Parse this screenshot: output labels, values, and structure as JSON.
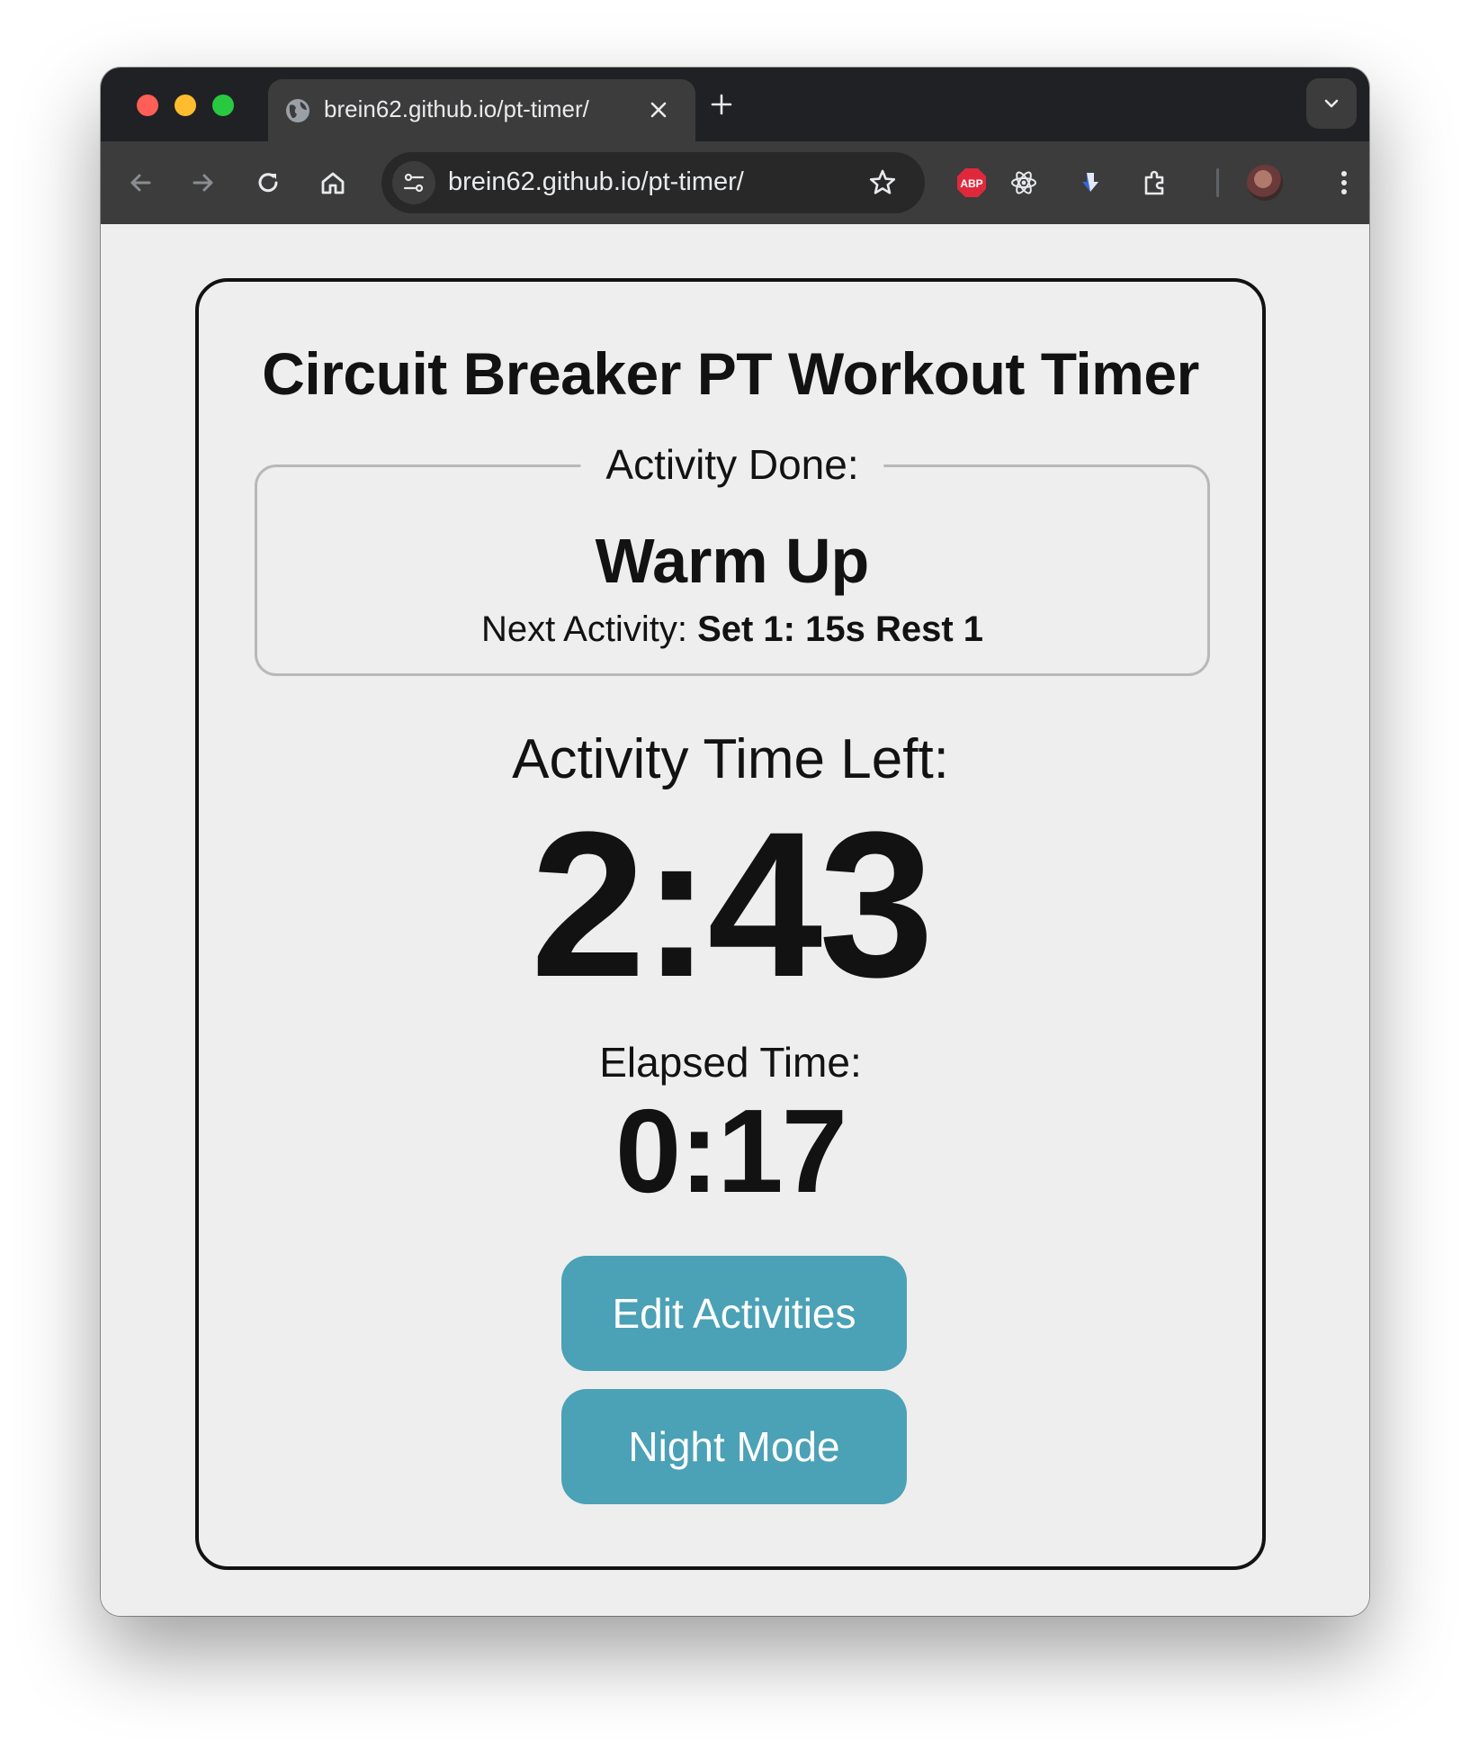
{
  "browser": {
    "tab_title": "brein62.github.io/pt-timer/",
    "url": "brein62.github.io/pt-timer/",
    "extension_abp_label": "ABP",
    "icons": {
      "back": "arrow-left-icon",
      "forward": "arrow-right-icon",
      "reload": "reload-icon",
      "home": "home-icon",
      "site_settings": "tune-icon",
      "bookmark": "star-icon",
      "adblock": "abp-icon",
      "react_devtools": "react-icon",
      "download": "download-arrow-icon",
      "extensions": "puzzle-icon",
      "menu": "kebab-menu-icon"
    }
  },
  "page": {
    "title": "Circuit Breaker PT Workout Timer",
    "activity_legend": "Activity Done:",
    "current_activity": "Warm Up",
    "next_activity_label": "Next Activity:",
    "next_activity_value": "Set 1: 15s Rest 1",
    "time_left_label": "Activity Time Left:",
    "time_left": "2:43",
    "elapsed_label": "Elapsed Time:",
    "elapsed": "0:17",
    "buttons": {
      "edit": "Edit Activities",
      "night": "Night Mode"
    }
  },
  "colors": {
    "button_bg": "#4ba1b6",
    "page_bg": "#eeeeee",
    "text": "#121212",
    "abp_red": "#e0283c"
  }
}
